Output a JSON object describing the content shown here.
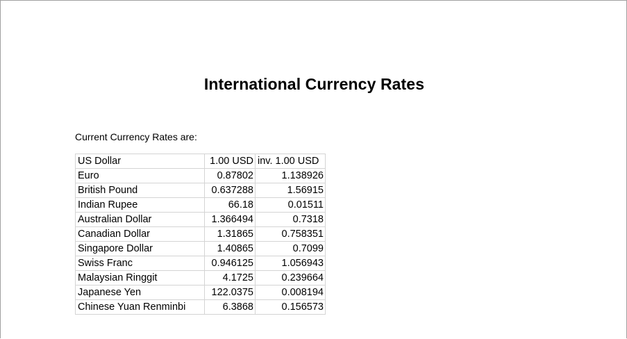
{
  "document": {
    "title": "International Currency Rates",
    "intro": "Current Currency Rates are:"
  },
  "table": {
    "headers": [
      "US Dollar",
      "1.00 USD",
      "inv. 1.00 USD"
    ],
    "rows": [
      {
        "currency": "Euro",
        "rate": "0.87802",
        "inverse": "1.138926"
      },
      {
        "currency": "British Pound",
        "rate": "0.637288",
        "inverse": "1.56915"
      },
      {
        "currency": "Indian Rupee",
        "rate": "66.18",
        "inverse": "0.01511"
      },
      {
        "currency": "Australian Dollar",
        "rate": "1.366494",
        "inverse": "0.7318"
      },
      {
        "currency": "Canadian Dollar",
        "rate": "1.31865",
        "inverse": "0.758351"
      },
      {
        "currency": "Singapore Dollar",
        "rate": "1.40865",
        "inverse": "0.7099"
      },
      {
        "currency": "Swiss Franc",
        "rate": "0.946125",
        "inverse": "1.056943"
      },
      {
        "currency": "Malaysian Ringgit",
        "rate": "4.1725",
        "inverse": "0.239664"
      },
      {
        "currency": "Japanese Yen",
        "rate": "122.0375",
        "inverse": "0.008194"
      },
      {
        "currency": "Chinese Yuan Renminbi",
        "rate": "6.3868",
        "inverse": "0.156573"
      }
    ]
  }
}
